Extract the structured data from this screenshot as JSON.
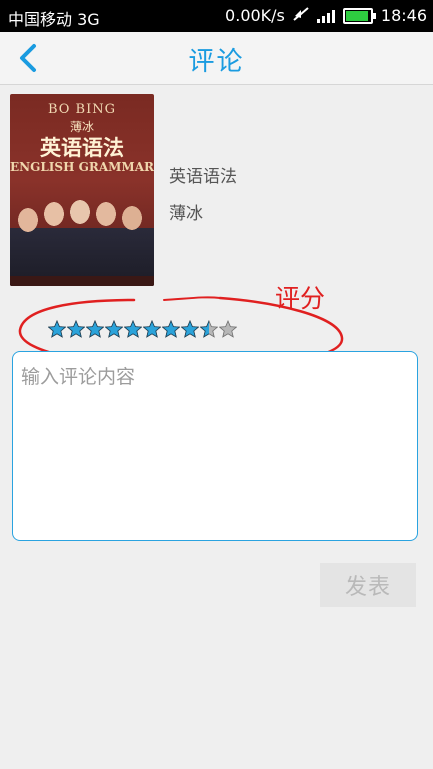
{
  "status_bar": {
    "carrier": "中国移动 3G",
    "net_speed": "0.00K/s",
    "time": "18:46"
  },
  "header": {
    "title": "评论",
    "back_icon": "chevron-left-icon"
  },
  "book": {
    "cover_lines": [
      "BO BING",
      "薄冰",
      "英语语法",
      "ENGLISH GRAMMAR"
    ],
    "title": "英语语法",
    "author": "薄冰"
  },
  "rating": {
    "annotation_label": "评分",
    "value": 8.5,
    "max": 10,
    "filled_color": "#2ba3da",
    "empty_color": "#b7b7b7"
  },
  "comment": {
    "placeholder": "输入评论内容",
    "value": ""
  },
  "submit_label": "发表",
  "colors": {
    "accent": "#1a9be0",
    "annotation": "#e02020"
  }
}
